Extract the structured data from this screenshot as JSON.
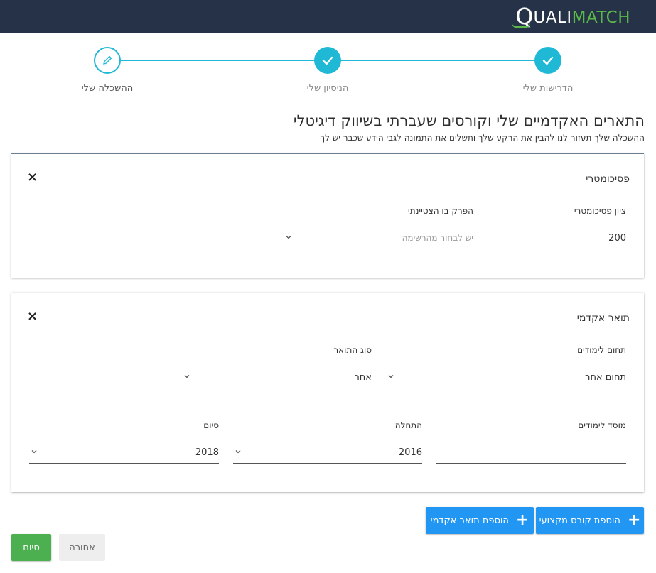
{
  "header": {
    "logo_q": "Q",
    "logo_part1": "UALI",
    "logo_part2": "MATCH",
    "brand_green": "#5bb947",
    "bar_color": "#263248"
  },
  "stepper": {
    "accent": "#1fb9d6",
    "steps": [
      {
        "label": "הדרישות שלי",
        "state": "done",
        "icon": "check-icon"
      },
      {
        "label": "הניסיון שלי",
        "state": "done",
        "icon": "check-icon"
      },
      {
        "label": "ההשכלה שלי",
        "state": "current",
        "icon": "pencil-icon"
      }
    ]
  },
  "page": {
    "title": "התארים האקדמיים שלי וקורסים שעברתי בשיווק דיגיטלי",
    "subtitle": "ההשכלה שלך תעזור לנו להבין את הרקע שלך ותשלים את התמונה לגבי הידע שכבר יש לך"
  },
  "psychometric": {
    "title": "פסיכומטרי",
    "close": "×",
    "score_label": "ציון פסיכומטרי",
    "score_value": "200",
    "section_label": "הפרק בו הצטיינתי",
    "section_placeholder": "יש לבחור מהרשימה"
  },
  "degree": {
    "title": "תואר אקדמי",
    "close": "×",
    "field_label": "תחום לימודים",
    "field_value": "תחום אחר",
    "type_label": "סוג התואר",
    "type_value": "אחר",
    "institution_label": "מוסד לימודים",
    "institution_value": "",
    "start_label": "התחלה",
    "start_value": "2016",
    "end_label": "סיום",
    "end_value": "2018"
  },
  "actions": {
    "add_course": "הוספת קורס מקצועי",
    "add_degree": "הוספת תואר אקדמי",
    "back": "אחורה",
    "finish": "סיום",
    "plus": "+"
  }
}
